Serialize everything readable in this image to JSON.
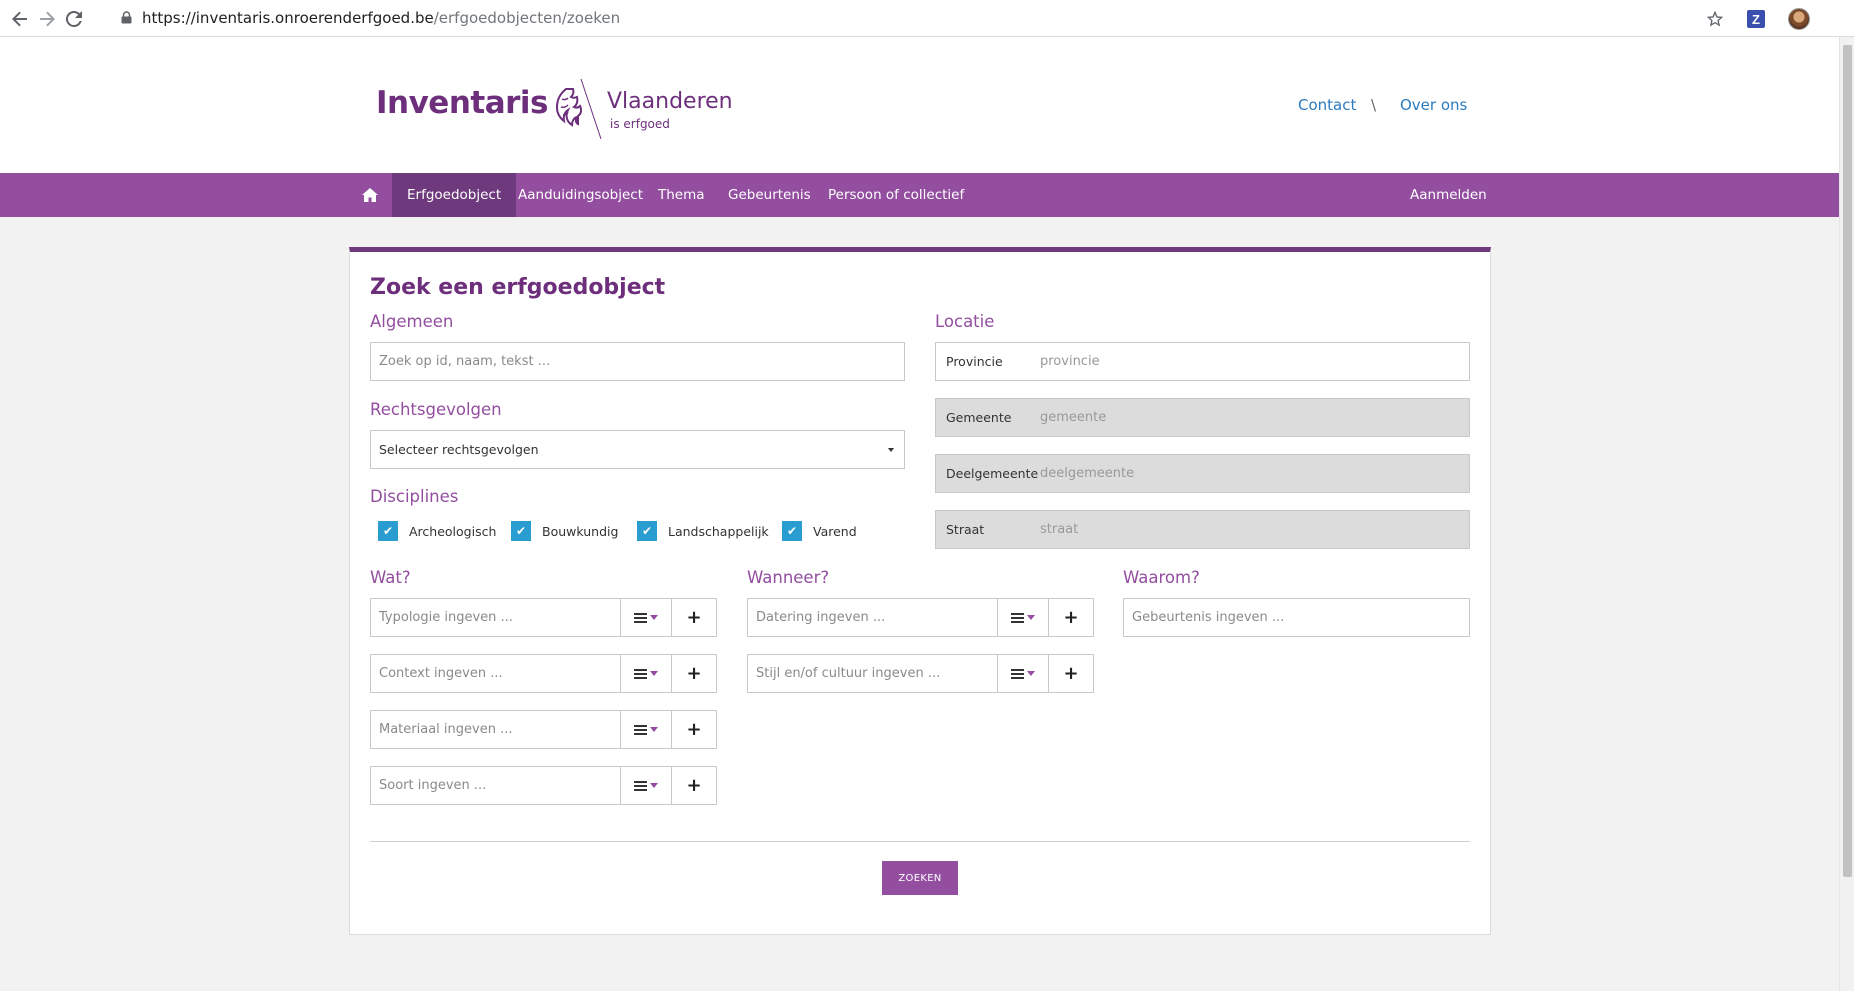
{
  "browser": {
    "url_host": "https://inventaris.onroerenderfgoed.be",
    "url_path": "/erfgoedobjecten/zoeken",
    "extension_label": "Z"
  },
  "header": {
    "title": "Inventaris",
    "brand_name": "Vlaanderen",
    "brand_sub": "is erfgoed",
    "links": [
      "Contact",
      "Over ons"
    ],
    "separator": "\\"
  },
  "nav": {
    "items": [
      "Erfgoedobject",
      "Aanduidingsobject",
      "Thema",
      "Gebeurtenis",
      "Persoon of collectief"
    ],
    "active": "Erfgoedobject",
    "login": "Aanmelden"
  },
  "form": {
    "title": "Zoek een erfgoedobject",
    "algemeen": {
      "label": "Algemeen",
      "placeholder": "Zoek op id, naam, tekst ..."
    },
    "rechtsgevolgen": {
      "label": "Rechtsgevolgen",
      "selected": "Selecteer rechtsgevolgen"
    },
    "disciplines": {
      "label": "Disciplines",
      "options": [
        {
          "label": "Archeologisch",
          "checked": true
        },
        {
          "label": "Bouwkundig",
          "checked": true
        },
        {
          "label": "Landschappelijk",
          "checked": true
        },
        {
          "label": "Varend",
          "checked": true
        }
      ]
    },
    "locatie": {
      "label": "Locatie",
      "rows": [
        {
          "label": "Provincie",
          "placeholder": "provincie",
          "disabled": false
        },
        {
          "label": "Gemeente",
          "placeholder": "gemeente",
          "disabled": true
        },
        {
          "label": "Deelgemeente",
          "placeholder": "deelgemeente",
          "disabled": true
        },
        {
          "label": "Straat",
          "placeholder": "straat",
          "disabled": true
        }
      ]
    },
    "wat": {
      "label": "Wat?",
      "fields": [
        "Typologie ingeven ...",
        "Context ingeven ...",
        "Materiaal ingeven ...",
        "Soort ingeven ..."
      ]
    },
    "wanneer": {
      "label": "Wanneer?",
      "fields": [
        "Datering ingeven ...",
        "Stijl en/of cultuur ingeven ..."
      ]
    },
    "waarom": {
      "label": "Waarom?",
      "placeholder": "Gebeurtenis ingeven ..."
    },
    "plus_symbol": "+",
    "check_symbol": "✔",
    "submit": "ZOEKEN"
  },
  "colors": {
    "brand_purple": "#6d2f7c",
    "nav_purple": "#934ea0",
    "nav_active": "#6f3a7d",
    "checkbox_blue": "#2a9dd0",
    "link_blue": "#2b7bbf"
  }
}
